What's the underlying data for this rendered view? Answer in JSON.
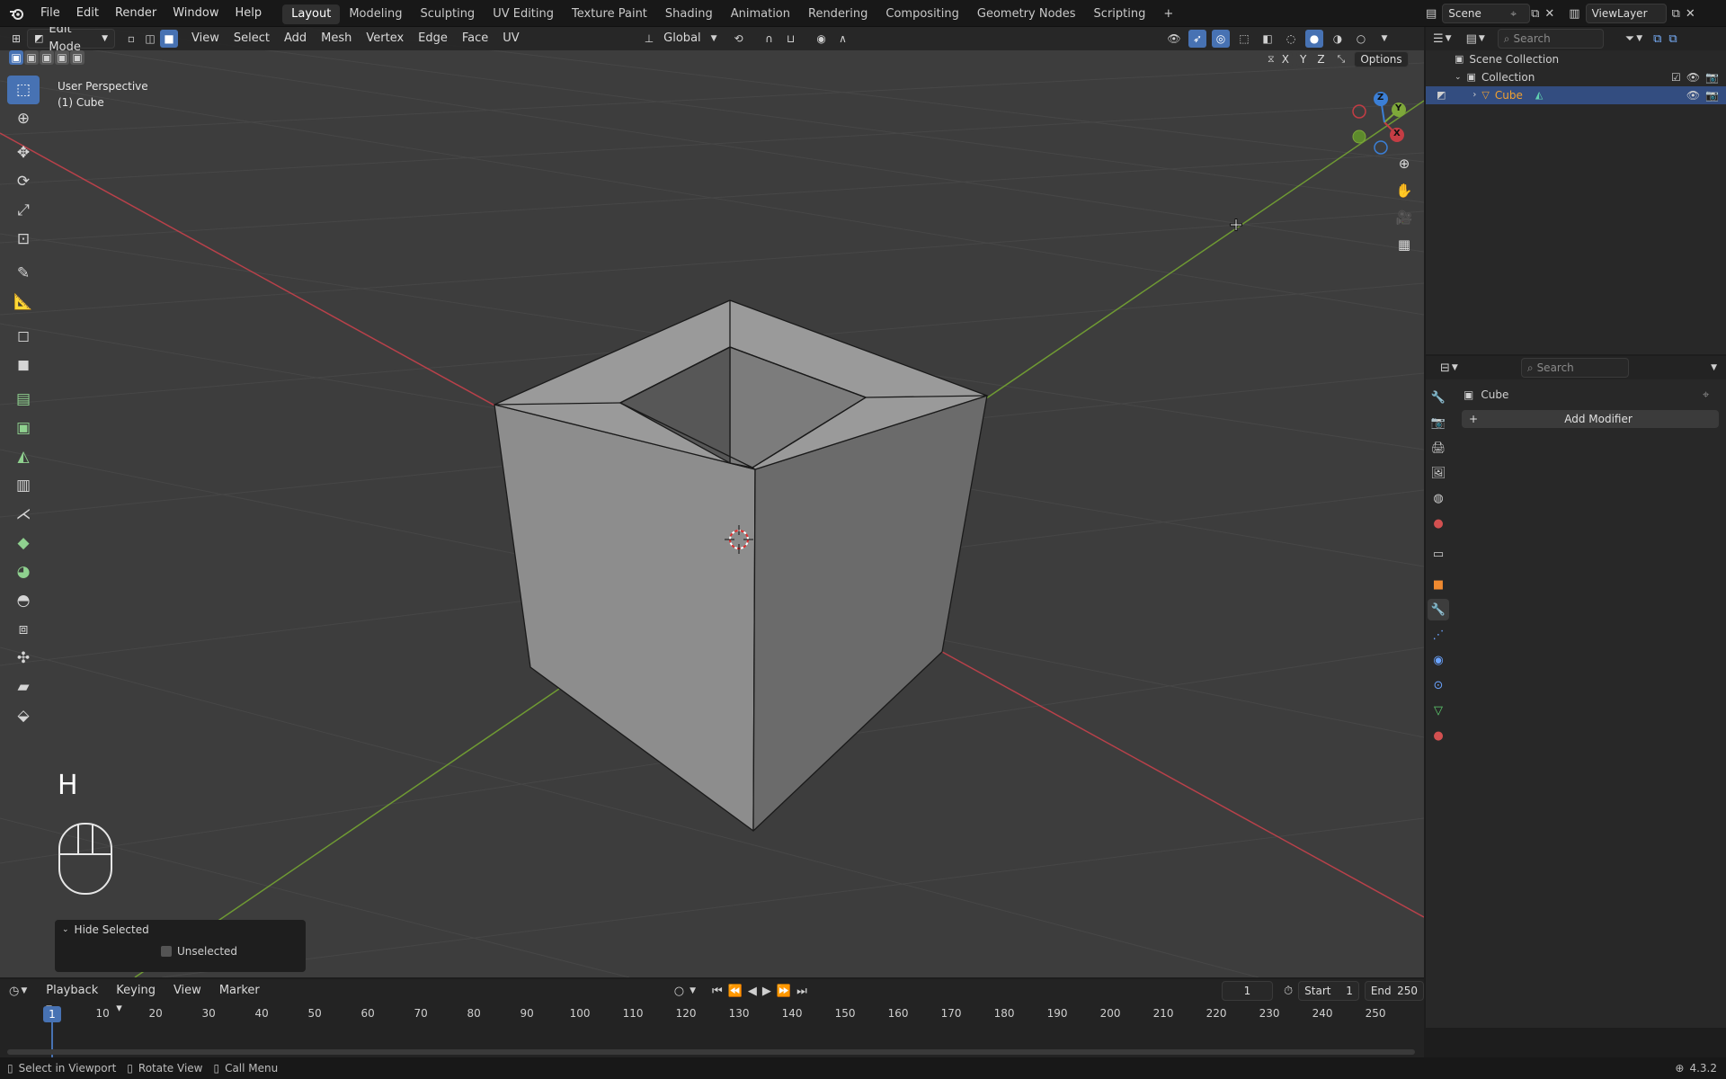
{
  "topbar": {
    "menus": [
      "File",
      "Edit",
      "Render",
      "Window",
      "Help"
    ],
    "workspaces": [
      "Layout",
      "Modeling",
      "Sculpting",
      "UV Editing",
      "Texture Paint",
      "Shading",
      "Animation",
      "Rendering",
      "Compositing",
      "Geometry Nodes",
      "Scripting"
    ],
    "active_workspace": "Layout",
    "add_tab": "+",
    "scene": "Scene",
    "view_layer": "ViewLayer"
  },
  "viewport_header": {
    "mode": "Edit Mode",
    "menus": [
      "View",
      "Select",
      "Add",
      "Mesh",
      "Vertex",
      "Edge",
      "Face",
      "UV"
    ],
    "transform_orientation": "Global",
    "axis_x": "X",
    "axis_y": "Y",
    "axis_z": "Z",
    "options": "Options"
  },
  "viewport": {
    "view_name": "User Perspective",
    "object_name": "(1) Cube",
    "key_pressed": "H",
    "gizmo_z": "Z",
    "gizmo_y": "Y",
    "gizmo_x": "X"
  },
  "operator_panel": {
    "title": "Hide Selected",
    "checkbox_label": "Unselected",
    "checked": false
  },
  "outliner": {
    "search_placeholder": "Search",
    "scene_collection": "Scene Collection",
    "collection": "Collection",
    "object": "Cube"
  },
  "properties": {
    "search_placeholder": "Search",
    "object_name": "Cube",
    "add_modifier": "Add Modifier"
  },
  "timeline": {
    "menus": [
      "Playback",
      "Keying",
      "View",
      "Marker"
    ],
    "current_frame": "1",
    "start_label": "Start",
    "start_value": "1",
    "end_label": "End",
    "end_value": "250",
    "ticks": [
      "1",
      "10",
      "20",
      "30",
      "40",
      "50",
      "60",
      "70",
      "80",
      "90",
      "100",
      "110",
      "120",
      "130",
      "140",
      "150",
      "160",
      "170",
      "180",
      "190",
      "200",
      "210",
      "220",
      "230",
      "240",
      "250"
    ]
  },
  "statusbar": {
    "select": "Select in Viewport",
    "rotate": "Rotate View",
    "call_menu": "Call Menu",
    "version": "4.3.2"
  },
  "colors": {
    "accent": "#4772b3",
    "x_axis": "#c43d44",
    "y_axis": "#7ea83a",
    "z_axis": "#3b7fd6"
  }
}
